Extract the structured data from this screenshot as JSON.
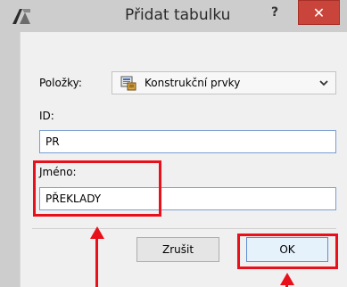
{
  "dialog": {
    "title": "Přidat tabulku",
    "help_label": "?",
    "close_label": "✕"
  },
  "form": {
    "items_label": "Položky:",
    "items_value": "Konstrukční prvky",
    "id_label": "ID:",
    "id_value": "PR",
    "name_label": "Jméno:",
    "name_value": "PŘEKLADY"
  },
  "buttons": {
    "cancel_label": "Zrušit",
    "ok_label": "OK"
  },
  "colors": {
    "highlight": "#e8101a",
    "close_button": "#c9443a",
    "input_border": "#7a9cd3"
  }
}
